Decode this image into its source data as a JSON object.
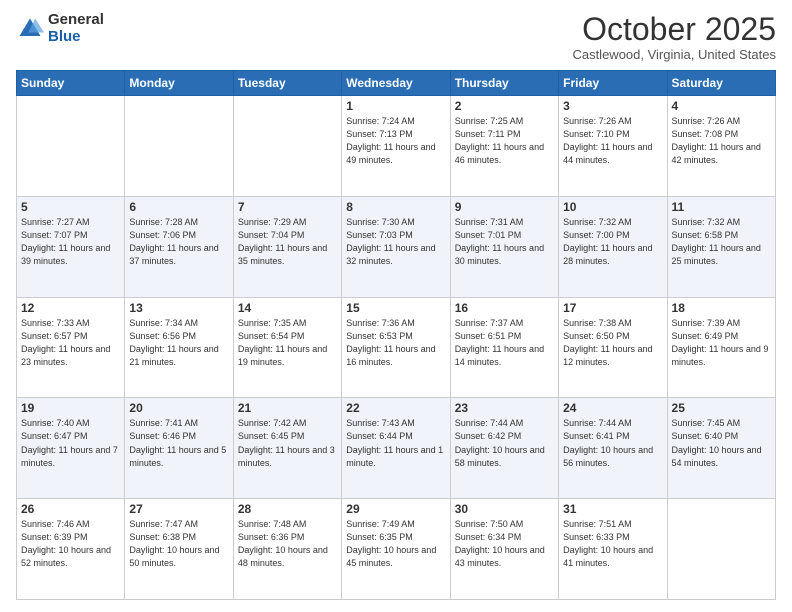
{
  "logo": {
    "general": "General",
    "blue": "Blue"
  },
  "header": {
    "month": "October 2025",
    "location": "Castlewood, Virginia, United States"
  },
  "weekdays": [
    "Sunday",
    "Monday",
    "Tuesday",
    "Wednesday",
    "Thursday",
    "Friday",
    "Saturday"
  ],
  "weeks": [
    [
      {
        "day": null
      },
      {
        "day": null
      },
      {
        "day": null
      },
      {
        "day": "1",
        "sunrise": "Sunrise: 7:24 AM",
        "sunset": "Sunset: 7:13 PM",
        "daylight": "Daylight: 11 hours and 49 minutes."
      },
      {
        "day": "2",
        "sunrise": "Sunrise: 7:25 AM",
        "sunset": "Sunset: 7:11 PM",
        "daylight": "Daylight: 11 hours and 46 minutes."
      },
      {
        "day": "3",
        "sunrise": "Sunrise: 7:26 AM",
        "sunset": "Sunset: 7:10 PM",
        "daylight": "Daylight: 11 hours and 44 minutes."
      },
      {
        "day": "4",
        "sunrise": "Sunrise: 7:26 AM",
        "sunset": "Sunset: 7:08 PM",
        "daylight": "Daylight: 11 hours and 42 minutes."
      }
    ],
    [
      {
        "day": "5",
        "sunrise": "Sunrise: 7:27 AM",
        "sunset": "Sunset: 7:07 PM",
        "daylight": "Daylight: 11 hours and 39 minutes."
      },
      {
        "day": "6",
        "sunrise": "Sunrise: 7:28 AM",
        "sunset": "Sunset: 7:06 PM",
        "daylight": "Daylight: 11 hours and 37 minutes."
      },
      {
        "day": "7",
        "sunrise": "Sunrise: 7:29 AM",
        "sunset": "Sunset: 7:04 PM",
        "daylight": "Daylight: 11 hours and 35 minutes."
      },
      {
        "day": "8",
        "sunrise": "Sunrise: 7:30 AM",
        "sunset": "Sunset: 7:03 PM",
        "daylight": "Daylight: 11 hours and 32 minutes."
      },
      {
        "day": "9",
        "sunrise": "Sunrise: 7:31 AM",
        "sunset": "Sunset: 7:01 PM",
        "daylight": "Daylight: 11 hours and 30 minutes."
      },
      {
        "day": "10",
        "sunrise": "Sunrise: 7:32 AM",
        "sunset": "Sunset: 7:00 PM",
        "daylight": "Daylight: 11 hours and 28 minutes."
      },
      {
        "day": "11",
        "sunrise": "Sunrise: 7:32 AM",
        "sunset": "Sunset: 6:58 PM",
        "daylight": "Daylight: 11 hours and 25 minutes."
      }
    ],
    [
      {
        "day": "12",
        "sunrise": "Sunrise: 7:33 AM",
        "sunset": "Sunset: 6:57 PM",
        "daylight": "Daylight: 11 hours and 23 minutes."
      },
      {
        "day": "13",
        "sunrise": "Sunrise: 7:34 AM",
        "sunset": "Sunset: 6:56 PM",
        "daylight": "Daylight: 11 hours and 21 minutes."
      },
      {
        "day": "14",
        "sunrise": "Sunrise: 7:35 AM",
        "sunset": "Sunset: 6:54 PM",
        "daylight": "Daylight: 11 hours and 19 minutes."
      },
      {
        "day": "15",
        "sunrise": "Sunrise: 7:36 AM",
        "sunset": "Sunset: 6:53 PM",
        "daylight": "Daylight: 11 hours and 16 minutes."
      },
      {
        "day": "16",
        "sunrise": "Sunrise: 7:37 AM",
        "sunset": "Sunset: 6:51 PM",
        "daylight": "Daylight: 11 hours and 14 minutes."
      },
      {
        "day": "17",
        "sunrise": "Sunrise: 7:38 AM",
        "sunset": "Sunset: 6:50 PM",
        "daylight": "Daylight: 11 hours and 12 minutes."
      },
      {
        "day": "18",
        "sunrise": "Sunrise: 7:39 AM",
        "sunset": "Sunset: 6:49 PM",
        "daylight": "Daylight: 11 hours and 9 minutes."
      }
    ],
    [
      {
        "day": "19",
        "sunrise": "Sunrise: 7:40 AM",
        "sunset": "Sunset: 6:47 PM",
        "daylight": "Daylight: 11 hours and 7 minutes."
      },
      {
        "day": "20",
        "sunrise": "Sunrise: 7:41 AM",
        "sunset": "Sunset: 6:46 PM",
        "daylight": "Daylight: 11 hours and 5 minutes."
      },
      {
        "day": "21",
        "sunrise": "Sunrise: 7:42 AM",
        "sunset": "Sunset: 6:45 PM",
        "daylight": "Daylight: 11 hours and 3 minutes."
      },
      {
        "day": "22",
        "sunrise": "Sunrise: 7:43 AM",
        "sunset": "Sunset: 6:44 PM",
        "daylight": "Daylight: 11 hours and 1 minute."
      },
      {
        "day": "23",
        "sunrise": "Sunrise: 7:44 AM",
        "sunset": "Sunset: 6:42 PM",
        "daylight": "Daylight: 10 hours and 58 minutes."
      },
      {
        "day": "24",
        "sunrise": "Sunrise: 7:44 AM",
        "sunset": "Sunset: 6:41 PM",
        "daylight": "Daylight: 10 hours and 56 minutes."
      },
      {
        "day": "25",
        "sunrise": "Sunrise: 7:45 AM",
        "sunset": "Sunset: 6:40 PM",
        "daylight": "Daylight: 10 hours and 54 minutes."
      }
    ],
    [
      {
        "day": "26",
        "sunrise": "Sunrise: 7:46 AM",
        "sunset": "Sunset: 6:39 PM",
        "daylight": "Daylight: 10 hours and 52 minutes."
      },
      {
        "day": "27",
        "sunrise": "Sunrise: 7:47 AM",
        "sunset": "Sunset: 6:38 PM",
        "daylight": "Daylight: 10 hours and 50 minutes."
      },
      {
        "day": "28",
        "sunrise": "Sunrise: 7:48 AM",
        "sunset": "Sunset: 6:36 PM",
        "daylight": "Daylight: 10 hours and 48 minutes."
      },
      {
        "day": "29",
        "sunrise": "Sunrise: 7:49 AM",
        "sunset": "Sunset: 6:35 PM",
        "daylight": "Daylight: 10 hours and 45 minutes."
      },
      {
        "day": "30",
        "sunrise": "Sunrise: 7:50 AM",
        "sunset": "Sunset: 6:34 PM",
        "daylight": "Daylight: 10 hours and 43 minutes."
      },
      {
        "day": "31",
        "sunrise": "Sunrise: 7:51 AM",
        "sunset": "Sunset: 6:33 PM",
        "daylight": "Daylight: 10 hours and 41 minutes."
      },
      {
        "day": null
      }
    ]
  ]
}
